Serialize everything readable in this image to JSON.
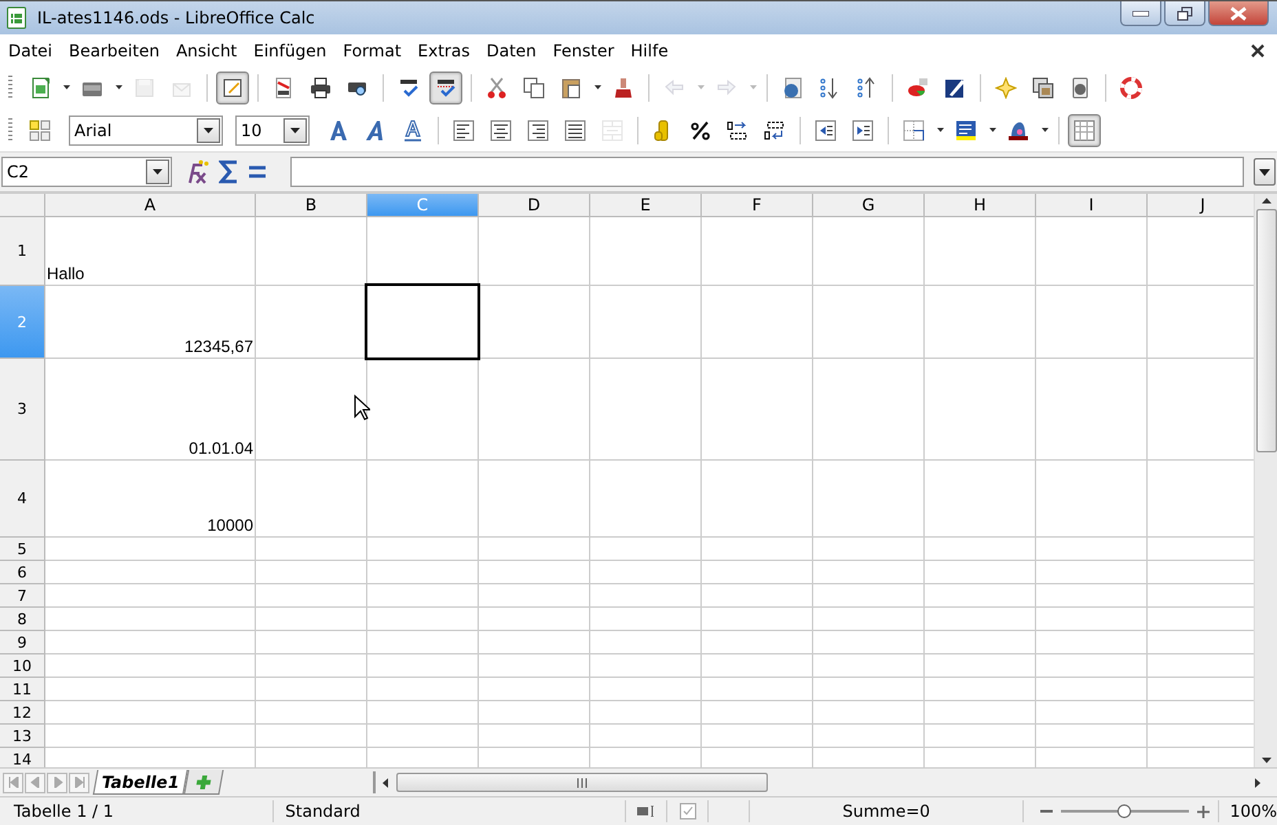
{
  "window": {
    "title": "IL-ates1146.ods - LibreOffice Calc"
  },
  "menu": [
    {
      "label": "Datei"
    },
    {
      "label": "Bearbeiten"
    },
    {
      "label": "Ansicht"
    },
    {
      "label": "Einfügen"
    },
    {
      "label": "Format"
    },
    {
      "label": "Extras"
    },
    {
      "label": "Daten"
    },
    {
      "label": "Fenster"
    },
    {
      "label": "Hilfe"
    }
  ],
  "toolbar_standard": [
    {
      "kind": "new",
      "dropdown": true,
      "disabled": false,
      "pressed": false
    },
    {
      "kind": "open",
      "dropdown": true,
      "disabled": false,
      "pressed": false
    },
    {
      "kind": "save",
      "dropdown": false,
      "disabled": true,
      "pressed": false
    },
    {
      "kind": "mail",
      "dropdown": false,
      "disabled": true,
      "pressed": false
    },
    {
      "kind": "sep"
    },
    {
      "kind": "edit",
      "dropdown": false,
      "disabled": false,
      "pressed": true
    },
    {
      "kind": "sep"
    },
    {
      "kind": "pdf",
      "dropdown": false,
      "disabled": false,
      "pressed": false
    },
    {
      "kind": "print",
      "dropdown": false,
      "disabled": false,
      "pressed": false
    },
    {
      "kind": "preview",
      "dropdown": false,
      "disabled": false,
      "pressed": false
    },
    {
      "kind": "sep"
    },
    {
      "kind": "spell",
      "dropdown": false,
      "disabled": false,
      "pressed": false
    },
    {
      "kind": "autospell",
      "dropdown": false,
      "disabled": false,
      "pressed": true
    },
    {
      "kind": "sep"
    },
    {
      "kind": "cut",
      "dropdown": false,
      "disabled": false,
      "pressed": false
    },
    {
      "kind": "copy",
      "dropdown": false,
      "disabled": false,
      "pressed": false
    },
    {
      "kind": "paste",
      "dropdown": true,
      "disabled": false,
      "pressed": false
    },
    {
      "kind": "brush",
      "dropdown": false,
      "disabled": false,
      "pressed": false
    },
    {
      "kind": "sep"
    },
    {
      "kind": "undo",
      "dropdown": true,
      "disabled": true,
      "pressed": false
    },
    {
      "kind": "redo",
      "dropdown": true,
      "disabled": true,
      "pressed": false
    },
    {
      "kind": "sep"
    },
    {
      "kind": "globe",
      "dropdown": false,
      "disabled": false,
      "pressed": false
    },
    {
      "kind": "sortdown",
      "dropdown": false,
      "disabled": false,
      "pressed": false
    },
    {
      "kind": "sortup",
      "dropdown": false,
      "disabled": false,
      "pressed": false
    },
    {
      "kind": "sep"
    },
    {
      "kind": "chart",
      "dropdown": false,
      "disabled": false,
      "pressed": false
    },
    {
      "kind": "draw",
      "dropdown": false,
      "disabled": false,
      "pressed": false
    },
    {
      "kind": "sep"
    },
    {
      "kind": "star",
      "dropdown": false,
      "disabled": false,
      "pressed": false
    },
    {
      "kind": "frames",
      "dropdown": false,
      "disabled": false,
      "pressed": false
    },
    {
      "kind": "datasource",
      "dropdown": false,
      "disabled": false,
      "pressed": false
    },
    {
      "kind": "sep"
    },
    {
      "kind": "help",
      "dropdown": false,
      "disabled": false,
      "pressed": false
    }
  ],
  "toolbar_format": {
    "font": "Arial",
    "size": "10",
    "buttons": [
      {
        "kind": "bold",
        "dropdown": false,
        "disabled": false,
        "pressed": false
      },
      {
        "kind": "italic",
        "dropdown": false,
        "disabled": false,
        "pressed": false
      },
      {
        "kind": "underline",
        "dropdown": false,
        "disabled": false,
        "pressed": false
      },
      {
        "kind": "sep"
      },
      {
        "kind": "left",
        "dropdown": false,
        "disabled": false,
        "pressed": false
      },
      {
        "kind": "center",
        "dropdown": false,
        "disabled": false,
        "pressed": false
      },
      {
        "kind": "right",
        "dropdown": false,
        "disabled": false,
        "pressed": false
      },
      {
        "kind": "justify",
        "dropdown": false,
        "disabled": false,
        "pressed": false
      },
      {
        "kind": "merge",
        "dropdown": false,
        "disabled": true,
        "pressed": false
      },
      {
        "kind": "sep"
      },
      {
        "kind": "coins",
        "dropdown": false,
        "disabled": false,
        "pressed": false
      },
      {
        "kind": "percent",
        "dropdown": false,
        "disabled": false,
        "pressed": false
      },
      {
        "kind": "adddec",
        "dropdown": false,
        "disabled": false,
        "pressed": false
      },
      {
        "kind": "deldec",
        "dropdown": false,
        "disabled": false,
        "pressed": false
      },
      {
        "kind": "sep"
      },
      {
        "kind": "outdent",
        "dropdown": false,
        "disabled": false,
        "pressed": false
      },
      {
        "kind": "indent",
        "dropdown": false,
        "disabled": false,
        "pressed": false
      },
      {
        "kind": "sep"
      },
      {
        "kind": "borders",
        "dropdown": true,
        "disabled": false,
        "pressed": false
      },
      {
        "kind": "bgcolor",
        "dropdown": true,
        "disabled": false,
        "pressed": false
      },
      {
        "kind": "fontcolor",
        "dropdown": true,
        "disabled": false,
        "pressed": false
      },
      {
        "kind": "sep"
      },
      {
        "kind": "gridlines",
        "dropdown": false,
        "disabled": false,
        "pressed": true
      }
    ]
  },
  "formula_bar": {
    "name_box": "C2"
  },
  "columns": [
    {
      "label": "A",
      "selected": false
    },
    {
      "label": "B",
      "selected": false
    },
    {
      "label": "C",
      "selected": true
    },
    {
      "label": "D",
      "selected": false
    },
    {
      "label": "E",
      "selected": false
    },
    {
      "label": "F",
      "selected": false
    },
    {
      "label": "G",
      "selected": false
    },
    {
      "label": "H",
      "selected": false
    },
    {
      "label": "I",
      "selected": false
    },
    {
      "label": "J",
      "selected": false
    }
  ],
  "rows": [
    {
      "header": "1",
      "selected": false,
      "cells": {
        "A": {
          "text": "Hallo",
          "kind": "text"
        }
      }
    },
    {
      "header": "2",
      "selected": true,
      "cells": {
        "A": {
          "text": "12345,67",
          "kind": "number"
        }
      }
    },
    {
      "header": "3",
      "selected": false,
      "cells": {
        "A": {
          "text": "01.01.04",
          "kind": "date"
        }
      }
    },
    {
      "header": "4",
      "selected": false,
      "cells": {
        "A": {
          "text": "10000",
          "kind": "number"
        }
      }
    },
    {
      "header": "5",
      "selected": false
    },
    {
      "header": "6",
      "selected": false
    },
    {
      "header": "7",
      "selected": false
    },
    {
      "header": "8",
      "selected": false
    },
    {
      "header": "9",
      "selected": false
    },
    {
      "header": "10",
      "selected": false
    },
    {
      "header": "11",
      "selected": false
    },
    {
      "header": "12",
      "selected": false
    },
    {
      "header": "13",
      "selected": false
    },
    {
      "header": "14",
      "selected": false
    }
  ],
  "sheet_tabs": [
    {
      "label": "Tabelle1",
      "selected": true
    }
  ],
  "status_bar": {
    "sheet": "Tabelle 1 / 1",
    "style": "Standard",
    "sum": "Summe=0",
    "zoom": "100%",
    "zoom_level": {
      "level": 0.5
    }
  }
}
